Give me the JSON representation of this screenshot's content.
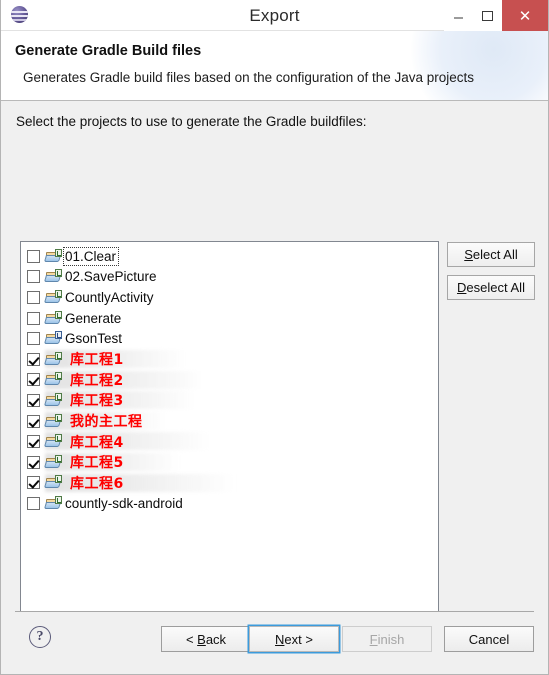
{
  "window": {
    "title": "Export",
    "app_icon": "eclipse-icon",
    "controls": {
      "minimize": "minimize-icon",
      "maximize": "maximize-icon",
      "close": "✕"
    }
  },
  "header": {
    "title": "Generate Gradle Build files",
    "description": "Generates Gradle build files based on the configuration of the Java projects"
  },
  "main": {
    "select_label_pre": "Select the projects to use to ",
    "select_label_mnemonic": "g",
    "select_label_post": "enerate the Gradle buildfiles:",
    "projects": [
      {
        "name": "01.Clear",
        "checked": false,
        "focused": true,
        "annotation": "",
        "smear": 0
      },
      {
        "name": "02.SavePicture",
        "checked": false,
        "focused": false,
        "annotation": "",
        "smear": 0
      },
      {
        "name": "CountlyActivity",
        "checked": false,
        "focused": false,
        "annotation": "",
        "smear": 0
      },
      {
        "name": "Generate",
        "checked": false,
        "focused": false,
        "annotation": "",
        "smear": 0
      },
      {
        "name": "GsonTest",
        "checked": false,
        "focused": false,
        "annotation": "",
        "smear": 0
      },
      {
        "name": "",
        "checked": true,
        "focused": false,
        "annotation": "库工程1",
        "smear": 140
      },
      {
        "name": "",
        "checked": true,
        "focused": false,
        "annotation": "库工程2",
        "smear": 160
      },
      {
        "name": "",
        "checked": true,
        "focused": false,
        "annotation": "库工程3",
        "smear": 150
      },
      {
        "name": "",
        "checked": true,
        "focused": false,
        "annotation": "我的主工程",
        "smear": 120
      },
      {
        "name": "",
        "checked": true,
        "focused": false,
        "annotation": "库工程4",
        "smear": 165
      },
      {
        "name": "",
        "checked": true,
        "focused": false,
        "annotation": "库工程5",
        "smear": 135
      },
      {
        "name": "",
        "checked": true,
        "focused": false,
        "annotation": "库工程6",
        "smear": 190
      },
      {
        "name": "countly-sdk-android",
        "checked": false,
        "focused": false,
        "annotation": "",
        "smear": 0
      }
    ],
    "select_all_label": "Select All",
    "select_all_mnemonic": "S",
    "deselect_all_label": "Deselect All",
    "deselect_all_mnemonic": "D"
  },
  "footer": {
    "help": "?",
    "back_label": "< Back",
    "back_mnemonic": "B",
    "next_label": "Next >",
    "next_mnemonic": "N",
    "finish_label": "Finish",
    "finish_mnemonic": "F",
    "finish_disabled": true,
    "cancel_label": "Cancel"
  },
  "colors": {
    "annotation_red": "#ff0000",
    "close_button": "#c75050",
    "focus_blue": "#3c9bdc"
  }
}
